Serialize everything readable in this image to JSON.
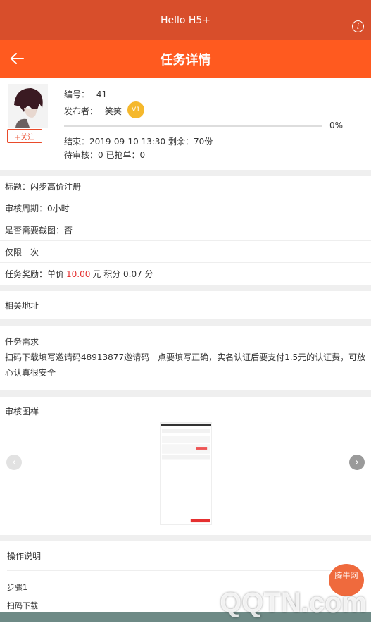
{
  "system_bar": {
    "title": "Hello H5+",
    "info_glyph": "i"
  },
  "header": {
    "title": "任务详情"
  },
  "publisher": {
    "id_label": "编号：",
    "id_value": "41",
    "publisher_label": "发布者：",
    "publisher_name": "笑笑",
    "badge": "V1",
    "follow_label": "+关注",
    "progress": 0,
    "progress_text": "0%",
    "end_line": "结束：2019-09-10 13:30   剩余：70份",
    "pending_line": "待审核：0    已抢单：0"
  },
  "info": {
    "rows": [
      "标题：闪步高价注册",
      "审核周期：0小时",
      "是否需要截图：否",
      "仅限一次"
    ],
    "reward_prefix": "任务奖励：单价",
    "reward_price": "10.00",
    "reward_suffix": "元  积分 0.07 分"
  },
  "address": {
    "label": "相关地址"
  },
  "requirement": {
    "label": "任务需求",
    "text": "扫码下载填写邀请码48913877邀请码一点要填写正确，实名认证后要支付1.5元的认证费，可放心认真很安全"
  },
  "gallery": {
    "label": "审核图样"
  },
  "operations": {
    "label": "操作说明",
    "steps": [
      "步骤1",
      "扫码下载"
    ]
  },
  "watermark": {
    "text": "QQTN.com",
    "badge": "腾牛网"
  },
  "colors": {
    "accent": "#ff5a1f",
    "system_bar": "#d84e2b",
    "price": "#e53030",
    "badge": "#f5b82c"
  }
}
